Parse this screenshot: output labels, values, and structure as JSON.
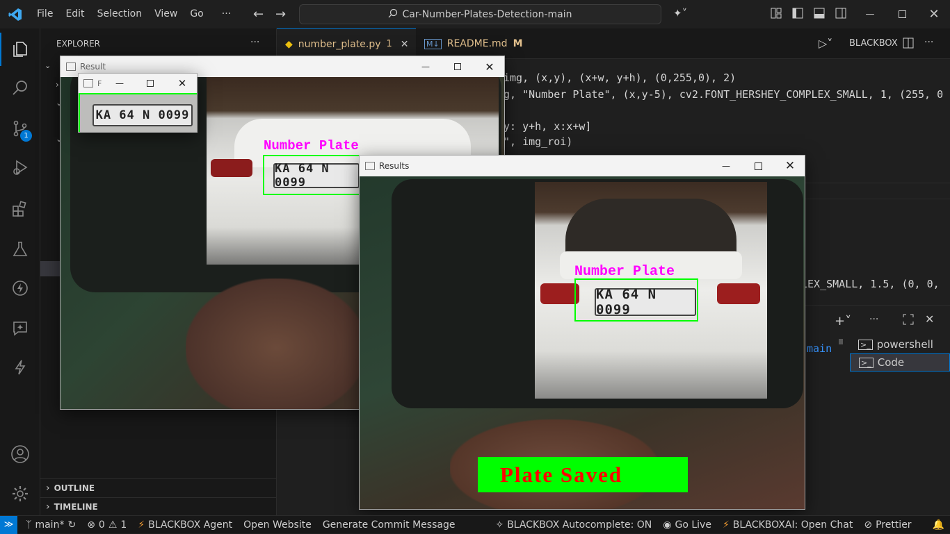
{
  "titlebar": {
    "menu": [
      "File",
      "Edit",
      "Selection",
      "View",
      "Go",
      "···"
    ],
    "search_text": "Car-Number-Plates-Detection-main"
  },
  "activity": {
    "scm_badge": "1"
  },
  "sidebar": {
    "title": "EXPLORER",
    "outline": "OUTLINE",
    "timeline": "TIMELINE"
  },
  "editor": {
    "tabs": [
      {
        "label": "number_plate.py",
        "badge": "1",
        "icon": "python-icon"
      },
      {
        "label": "README.md",
        "badge": "M",
        "icon": "markdown-icon"
      }
    ],
    "blackbox_label": "BLACKBOX",
    "code_lines": [
      "img, (x,y), (x+w, y+h), (0,255,0), 2)",
      "g, \"Number Plate\", (x,y-5), cv2.FONT_HERSHEY_COMPLEX_SMALL, 1, (255, 0",
      "",
      "y: y+h, x:x+w]",
      "\", img_roi)"
    ],
    "code_line_lower": "LEX_SMALL, 1.5, (0, 0,",
    "terminal_text": "main",
    "terminals": [
      {
        "label": "powershell",
        "active": false
      },
      {
        "label": "Code",
        "active": true
      }
    ]
  },
  "windows": {
    "result": {
      "title": "Result",
      "label": "Number Plate",
      "plate": "KA 64 N 0099"
    },
    "roi": {
      "title": "F",
      "plate": "KA 64 N 0099"
    },
    "results": {
      "title": "Results",
      "label": "Number Plate",
      "plate": "KA 64 N 0099",
      "banner": "Plate Saved"
    }
  },
  "statusbar": {
    "branch": "main*",
    "errors": "0",
    "warnings": "1",
    "items": [
      "BLACKBOX Agent",
      "Open Website",
      "Generate Commit Message",
      "BLACKBOX Autocomplete: ON",
      "Go Live",
      "BLACKBOXAI: Open Chat",
      "Prettier"
    ]
  },
  "colors": {
    "accent": "#0078d4",
    "box_green": "#00ff00",
    "label_magenta": "#ff00ff",
    "banner_red": "#ff0000"
  }
}
